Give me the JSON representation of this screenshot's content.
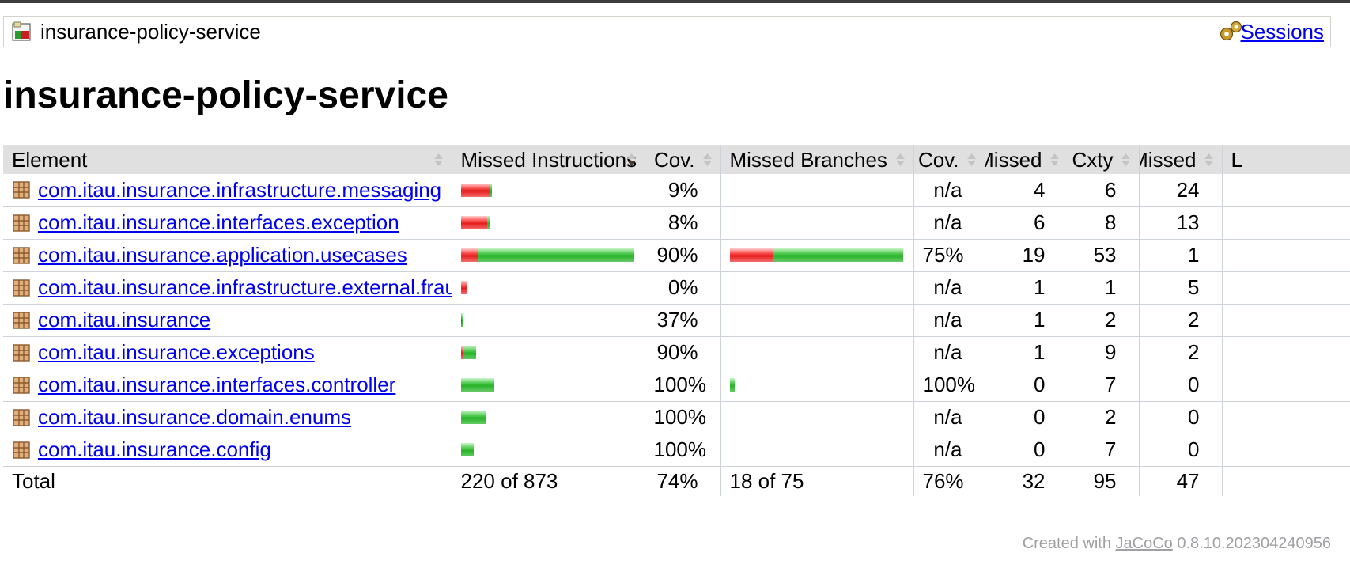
{
  "breadcrumb": {
    "title": "insurance-policy-service",
    "sessions_label": "Sessions",
    "report_icon": "report-icon",
    "sessions_icon": "gears-icon"
  },
  "page_title": "insurance-policy-service",
  "table": {
    "headers": [
      "Element",
      "Missed Instructions",
      "Cov.",
      "Missed Branches",
      "Cov.",
      "Missed",
      "Cxty",
      "Missed",
      "L"
    ],
    "rows": [
      {
        "name": "com.itau.insurance.infrastructure.messaging",
        "instr_missed": 0.91,
        "instr_cov_fraction": 0.09,
        "instr_cov": "9%",
        "branch_missed": null,
        "branch_cov_fraction": null,
        "branch_cov": "n/a",
        "cxty_missed": "4",
        "cxty": "6",
        "lines_missed": "24"
      },
      {
        "name": "com.itau.insurance.interfaces.exception",
        "instr_missed": 0.92,
        "instr_cov_fraction": 0.08,
        "instr_cov": "8%",
        "branch_missed": null,
        "branch_cov_fraction": null,
        "branch_cov": "n/a",
        "cxty_missed": "6",
        "cxty": "8",
        "lines_missed": "13"
      },
      {
        "name": "com.itau.insurance.application.usecases",
        "instr_missed": 0.1,
        "instr_cov_fraction": 0.9,
        "instr_cov": "90%",
        "branch_missed": 0.25,
        "branch_cov_fraction": 0.75,
        "branch_cov": "75%",
        "cxty_missed": "19",
        "cxty": "53",
        "lines_missed": "1"
      },
      {
        "name": "com.itau.insurance.infrastructure.external.fraud",
        "instr_missed": 1.0,
        "instr_cov_fraction": 0.0,
        "instr_cov": "0%",
        "branch_missed": null,
        "branch_cov_fraction": null,
        "branch_cov": "n/a",
        "cxty_missed": "1",
        "cxty": "1",
        "lines_missed": "5"
      },
      {
        "name": "com.itau.insurance",
        "instr_missed": 0.63,
        "instr_cov_fraction": 0.37,
        "instr_cov": "37%",
        "branch_missed": null,
        "branch_cov_fraction": null,
        "branch_cov": "n/a",
        "cxty_missed": "1",
        "cxty": "2",
        "lines_missed": "2"
      },
      {
        "name": "com.itau.insurance.exceptions",
        "instr_missed": 0.1,
        "instr_cov_fraction": 0.9,
        "instr_cov": "90%",
        "branch_missed": null,
        "branch_cov_fraction": null,
        "branch_cov": "n/a",
        "cxty_missed": "1",
        "cxty": "9",
        "lines_missed": "2"
      },
      {
        "name": "com.itau.insurance.interfaces.controller",
        "instr_missed": 0.0,
        "instr_cov_fraction": 1.0,
        "instr_cov": "100%",
        "branch_missed": 0.0,
        "branch_cov_fraction": 1.0,
        "branch_cov": "100%",
        "cxty_missed": "0",
        "cxty": "7",
        "lines_missed": "0"
      },
      {
        "name": "com.itau.insurance.domain.enums",
        "instr_missed": 0.0,
        "instr_cov_fraction": 1.0,
        "instr_cov": "100%",
        "branch_missed": null,
        "branch_cov_fraction": null,
        "branch_cov": "n/a",
        "cxty_missed": "0",
        "cxty": "2",
        "lines_missed": "0"
      },
      {
        "name": "com.itau.insurance.config",
        "instr_missed": 0.0,
        "instr_cov_fraction": 1.0,
        "instr_cov": "100%",
        "branch_missed": null,
        "branch_cov_fraction": null,
        "branch_cov": "n/a",
        "cxty_missed": "0",
        "cxty": "7",
        "lines_missed": "0"
      }
    ],
    "bar_scale_fractions": {
      "instr": [
        0.18,
        0.165,
        1.0,
        0.03,
        0.01,
        0.085,
        0.19,
        0.145,
        0.075
      ],
      "branch": [
        null,
        null,
        1.0,
        null,
        null,
        null,
        0.02,
        null,
        null
      ]
    },
    "total": {
      "label": "Total",
      "instr": "220 of 873",
      "instr_cov": "74%",
      "branch": "18 of 75",
      "branch_cov": "76%",
      "cxty_missed": "32",
      "cxty": "95",
      "lines_missed": "47"
    }
  },
  "footer": {
    "prefix": "Created with ",
    "link": "JaCoCo",
    "version": " 0.8.10.202304240956"
  },
  "colors": {
    "link": "#0000ee",
    "header_bg": "#e0e0e0",
    "bar_red": "#e41d1d",
    "bar_green": "#27b327",
    "footer_text": "#a0a0a4"
  }
}
